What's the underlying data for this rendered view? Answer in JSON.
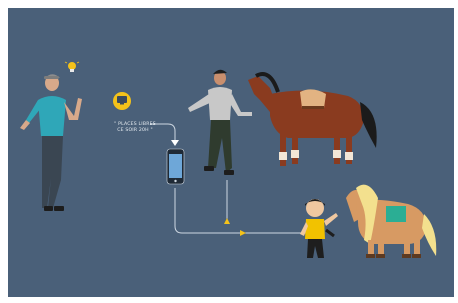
{
  "message": {
    "line1": "\" PLACES LIBRES",
    "line2": "CE SOIR 20H \""
  },
  "icons": {
    "idea": "lightbulb-icon",
    "screen": "computer-monitor-icon",
    "phone": "smartphone-icon",
    "direction": "triangle-arrow-icon"
  },
  "colors": {
    "background": "#4a6079",
    "accent_yellow": "#f4c21a",
    "connector_line": "#cfd8e2",
    "horse_brown": "#8a3b1f",
    "pony_tan": "#d79a63"
  }
}
